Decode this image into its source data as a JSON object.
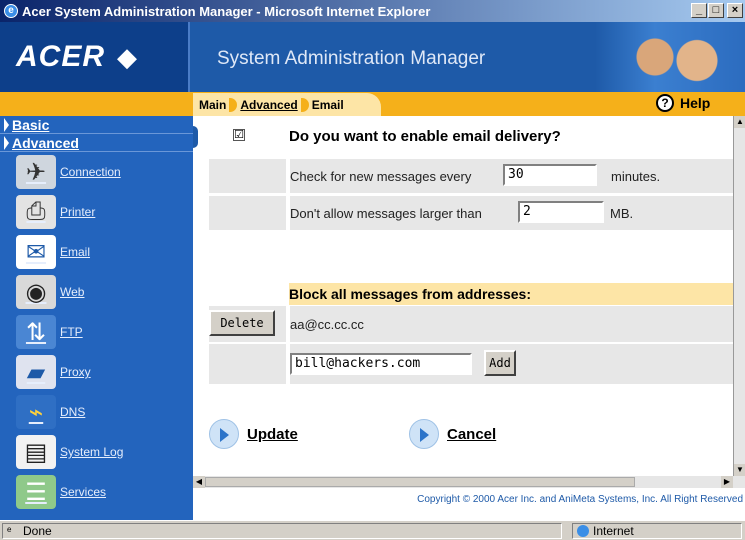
{
  "window": {
    "title": "Acer System Administration Manager - Microsoft Internet Explorer"
  },
  "header": {
    "logo": "ACER",
    "app_title": "System Administration Manager"
  },
  "breadcrumb": {
    "main": "Main",
    "advanced": "Advanced",
    "current": "Email"
  },
  "help": {
    "label": "Help"
  },
  "sidebar": {
    "sections": [
      "Basic",
      "Advanced"
    ],
    "items": [
      {
        "label": "Connection",
        "icon": "connection-icon"
      },
      {
        "label": "Printer",
        "icon": "printer-icon"
      },
      {
        "label": "Email",
        "icon": "email-icon"
      },
      {
        "label": "Web",
        "icon": "web-icon"
      },
      {
        "label": "FTP",
        "icon": "ftp-icon"
      },
      {
        "label": "Proxy",
        "icon": "proxy-icon"
      },
      {
        "label": "DNS",
        "icon": "dns-icon"
      },
      {
        "label": "System Log",
        "icon": "system-log-icon"
      },
      {
        "label": "Services",
        "icon": "services-icon"
      }
    ]
  },
  "email": {
    "enable_question": "Do you want to enable email delivery?",
    "enable_checked": "☑",
    "check_label": "Check for new messages every",
    "check_value": "30",
    "check_unit": "minutes.",
    "max_label": "Don't allow messages larger than",
    "max_value": "2",
    "max_unit": "MB.",
    "block_heading": "Block all messages from addresses:",
    "blocked_address": "aa@cc.cc.cc",
    "delete_label": "Delete",
    "new_address_value": "bill@hackers.com",
    "add_label": "Add"
  },
  "actions": {
    "update": "Update",
    "cancel": "Cancel"
  },
  "footer": {
    "copyright": "Copyright © 2000   Acer Inc. and AniMeta Systems, Inc.   All Right Reserved"
  },
  "status": {
    "left": "Done",
    "zone": "Internet"
  }
}
